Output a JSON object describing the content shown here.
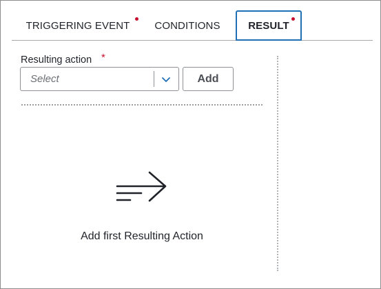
{
  "tabs": [
    {
      "label": "TRIGGERING EVENT",
      "required": true,
      "active": false
    },
    {
      "label": "CONDITIONS",
      "required": false,
      "active": false
    },
    {
      "label": "RESULT",
      "required": true,
      "active": true
    }
  ],
  "form": {
    "field_label": "Resulting action",
    "required_marker": "*",
    "select_placeholder": "Select",
    "add_label": "Add"
  },
  "empty_state": {
    "icon": "arrow-right-lines-icon",
    "message": "Add first Resulting Action"
  },
  "colors": {
    "accent": "#1f6fb4",
    "required": "#c8102e",
    "border": "#8e9196",
    "text": "#1f2329"
  }
}
